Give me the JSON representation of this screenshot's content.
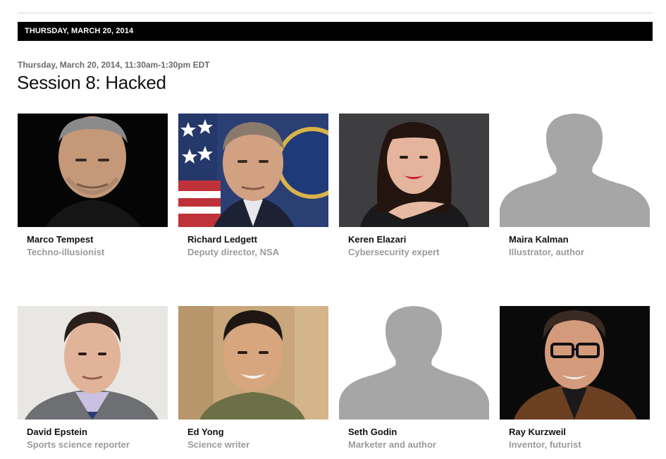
{
  "header": {
    "date_bar": "THURSDAY, MARCH 20, 2014"
  },
  "session": {
    "time": "Thursday, March 20, 2014, 11:30am-1:30pm EDT",
    "title": "Session 8: Hacked"
  },
  "speakers": [
    {
      "name": "Marco Tempest",
      "role": "Techno-illusionist",
      "photo": "portrait-photo"
    },
    {
      "name": "Richard Ledgett",
      "role": "Deputy director, NSA",
      "photo": "portrait-photo"
    },
    {
      "name": "Keren Elazari",
      "role": "Cybersecurity expert",
      "photo": "portrait-photo"
    },
    {
      "name": "Maira Kalman",
      "role": "Illustrator, author",
      "photo": "silhouette-placeholder"
    },
    {
      "name": "David Epstein",
      "role": "Sports science reporter",
      "photo": "portrait-photo"
    },
    {
      "name": "Ed Yong",
      "role": "Science writer",
      "photo": "portrait-photo"
    },
    {
      "name": "Seth Godin",
      "role": "Marketer and author",
      "photo": "silhouette-placeholder"
    },
    {
      "name": "Ray Kurzweil",
      "role": "Inventor, futurist",
      "photo": "portrait-photo"
    }
  ],
  "colors": {
    "date_bar_bg": "#000000",
    "date_bar_text": "#ffffff",
    "name_text": "#111111",
    "role_text": "#9b9b9b",
    "placeholder_bg": "#ffffff",
    "placeholder_silhouette": "#a6a6a6"
  }
}
